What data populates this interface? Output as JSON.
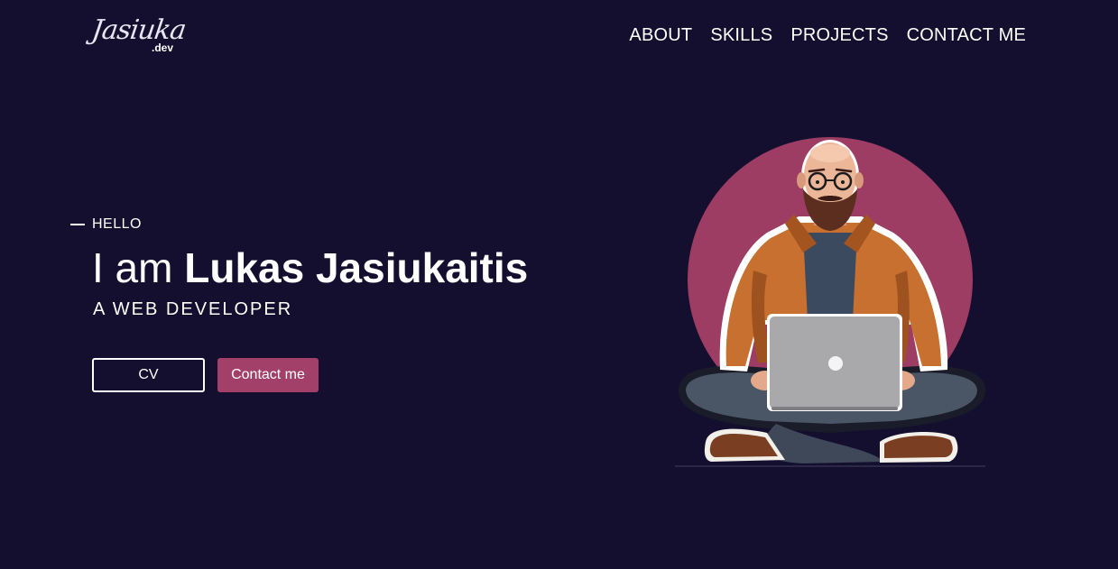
{
  "logo": {
    "script": "Jasiuka",
    "suffix": ".dev"
  },
  "nav": [
    "ABOUT",
    "SKILLS",
    "PROJECTS",
    "CONTACT ME"
  ],
  "hero": {
    "greeting": "HELLO",
    "intro": "I am",
    "name": "Lukas Jasiukaitis",
    "role": "A WEB DEVELOPER",
    "cv_label": "CV",
    "contact_label": "Contact me"
  },
  "colors": {
    "background": "#140f2e",
    "accent": "#a3406a",
    "text": "#ffffff"
  },
  "icons": {
    "hero_image": "developer-with-laptop-illustration"
  }
}
